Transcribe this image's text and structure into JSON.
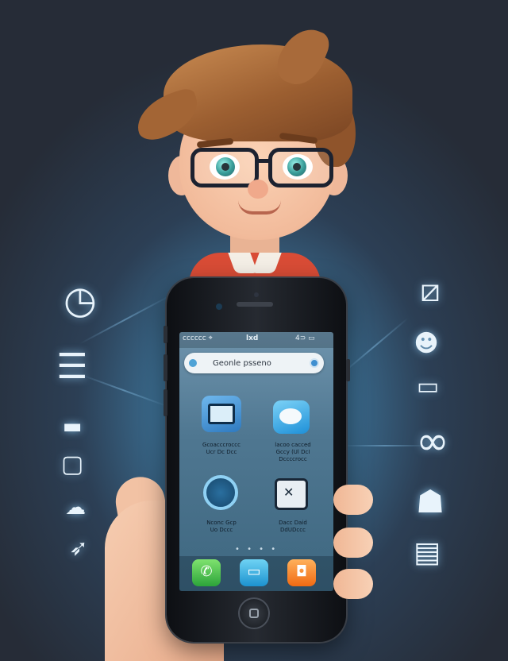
{
  "status_bar": {
    "carrier": "cccccc",
    "signal_glyph": "⌖",
    "app_name": "lxd",
    "battery": "4⊃ ▭"
  },
  "search": {
    "value": "Geonle psseno"
  },
  "apps": [
    {
      "label_line1": "Gcoacccroccc",
      "label_line2": "Ucr Dc Dcc",
      "icon": "notebook-icon"
    },
    {
      "label_line1": "lacoo cacced",
      "label_line2": "Gccy (Ul DcI",
      "label_line3": "Dccccrocc",
      "icon": "chat-bubble-icon"
    },
    {
      "label_line1": "Nconc Gcp",
      "label_line2": "Uo Dccc",
      "icon": "clock-icon"
    },
    {
      "label_line1": "Dacc Daid",
      "label_line2": "DdUDccc",
      "icon": "calendar-icon"
    }
  ],
  "page_indicator": "• • • •",
  "dock": [
    {
      "name": "phone",
      "glyph": "✆",
      "color": "#2ca43a"
    },
    {
      "name": "messages",
      "glyph": "▭",
      "color": "#1c92cf"
    },
    {
      "name": "chat",
      "glyph": "◘",
      "color": "#f06a12"
    }
  ],
  "floating_icons_left": [
    {
      "name": "clock-badge-icon",
      "glyph": "◷"
    },
    {
      "name": "document-icon",
      "glyph": "☰"
    },
    {
      "name": "keyboard-icon",
      "glyph": "▬"
    },
    {
      "name": "frame-icon",
      "glyph": "▢"
    },
    {
      "name": "cloud-icon",
      "glyph": "☁"
    },
    {
      "name": "rocket-icon",
      "glyph": "➶"
    }
  ],
  "floating_icons_right": [
    {
      "name": "edit-icon",
      "glyph": "⧄"
    },
    {
      "name": "contact-icon",
      "glyph": "☻"
    },
    {
      "name": "window-icon",
      "glyph": "▭"
    },
    {
      "name": "binoculars-icon",
      "glyph": "∞"
    },
    {
      "name": "inbox-icon",
      "glyph": "☗"
    },
    {
      "name": "list-icon",
      "glyph": "▤"
    }
  ]
}
